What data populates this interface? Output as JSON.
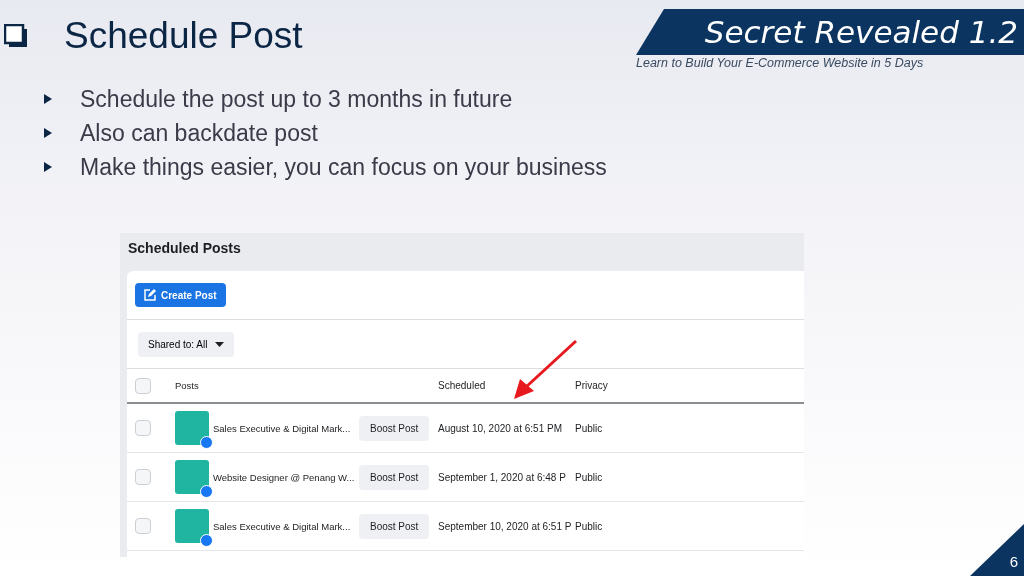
{
  "slide": {
    "title": "Schedule Post",
    "bullets": [
      "Schedule the post up to 3 months in future",
      "Also can backdate post",
      "Make things easier, you can focus on your business"
    ],
    "banner": {
      "title": "Secret Revealed 1.2",
      "subtitle": "Learn to Build Your E-Commerce Website in 5 Days"
    },
    "page_number": "6"
  },
  "screenshot": {
    "heading": "Scheduled Posts",
    "create_button": "Create Post",
    "filter": "Shared to: All",
    "columns": [
      {
        "label": "Posts"
      },
      {
        "label": "Scheduled"
      },
      {
        "label": "Privacy"
      }
    ],
    "header_checked": false,
    "rows": [
      {
        "checked": false,
        "post": "Sales Executive & Digital Mark...",
        "action": "Boost Post",
        "scheduled": "August 10, 2020 at 6:51 PM",
        "privacy": "Public"
      },
      {
        "checked": false,
        "post": "Website Designer @ Penang W...",
        "action": "Boost Post",
        "scheduled": "September 1, 2020 at 6:48 P",
        "privacy": "Public"
      },
      {
        "checked": false,
        "post": "Sales Executive & Digital Mark...",
        "action": "Boost Post",
        "scheduled": "September 10, 2020 at 6:51 P",
        "privacy": "Public"
      }
    ]
  }
}
